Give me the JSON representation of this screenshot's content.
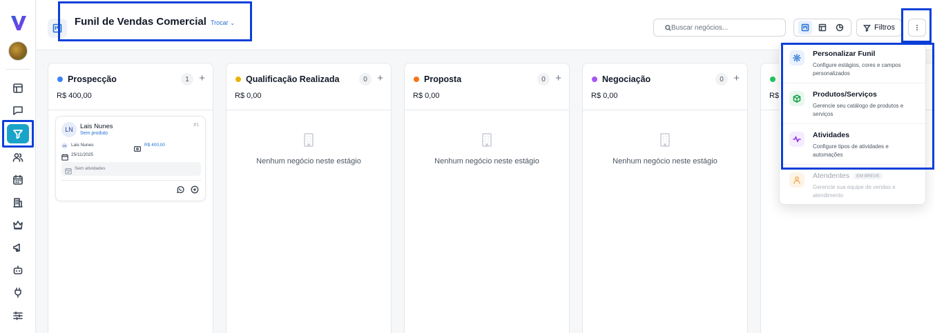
{
  "sidebar": {
    "logo_letter": "V",
    "items": [
      {
        "icon": "dashboard-icon"
      },
      {
        "icon": "chat-icon"
      },
      {
        "icon": "funnel-icon",
        "active": true
      },
      {
        "icon": "users-icon"
      },
      {
        "icon": "calendar-icon"
      },
      {
        "icon": "building-icon"
      },
      {
        "icon": "crown-icon"
      },
      {
        "icon": "megaphone-icon"
      },
      {
        "icon": "bot-icon"
      },
      {
        "icon": "plug-icon"
      },
      {
        "icon": "sliders-icon"
      }
    ]
  },
  "header": {
    "title": "Funil de Vendas Comercial",
    "switch_label": "Trocar",
    "search_placeholder": "Buscar negócios...",
    "filters_label": "Filtros"
  },
  "columns": [
    {
      "name": "Prospecção",
      "color": "#3b82f6",
      "count": "1",
      "total": "R$ 400,00"
    },
    {
      "name": "Qualificação Realizada",
      "color": "#eab308",
      "count": "0",
      "total": "R$ 0,00",
      "empty_text": "Nenhum negócio neste estágio"
    },
    {
      "name": "Proposta",
      "color": "#f97316",
      "count": "0",
      "total": "R$ 0,00",
      "empty_text": "Nenhum negócio neste estágio"
    },
    {
      "name": "Negociação",
      "color": "#a855f7",
      "count": "0",
      "total": "R$ 0,00",
      "empty_text": "Nenhum negócio neste estágio"
    },
    {
      "name": "",
      "color": "#22c55e",
      "count": "",
      "total": "R$"
    }
  ],
  "deal": {
    "initials": "LN",
    "name": "Lais Nunes",
    "product": "Sem produto",
    "number": "#1",
    "owner_initials": "LN",
    "owner": "Lais Nunes",
    "value": "R$ 400,00",
    "date": "25/11/2025",
    "activities": "Sem atividades"
  },
  "menu": {
    "items": [
      {
        "title": "Personalizar Funil",
        "desc": "Configure estágios, cores e campos personalizados",
        "icon": "gear-icon",
        "color": "#1f6fd1"
      },
      {
        "title": "Produtos/Serviços",
        "desc": "Gerencie seu catálogo de produtos e serviços",
        "icon": "box-icon",
        "color": "#16a34a"
      },
      {
        "title": "Atividades",
        "desc": "Configure tipos de atividades e automações",
        "icon": "activity-icon",
        "color": "#9333ea"
      },
      {
        "title": "Atendentes",
        "badge": "EM BREVE",
        "desc": "Gerencie sua equipe de vendas e atendimento",
        "icon": "user-icon",
        "color": "#f59e0b"
      }
    ]
  }
}
